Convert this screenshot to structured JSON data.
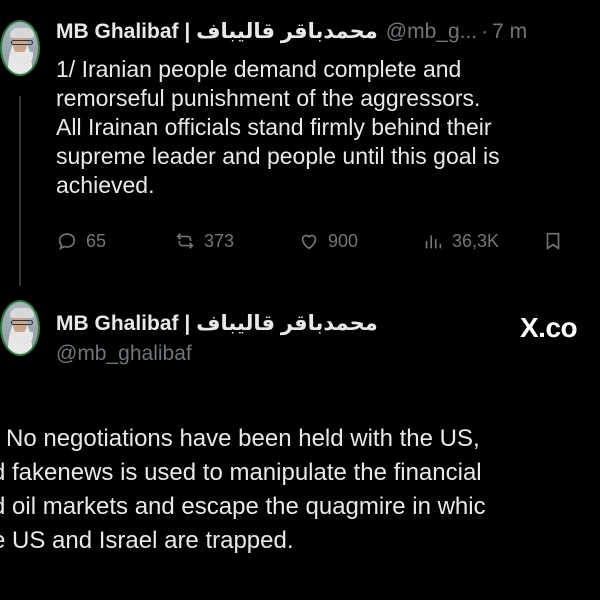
{
  "tweet1": {
    "display_name": "MB Ghalibaf | محمدباقر قالیباف",
    "handle": "@mb_g...",
    "separator": "·",
    "time": "7 m",
    "lines": [
      "1/ Iranian people demand complete and",
      "remorseful punishment of the aggressors.",
      "All Irainan officials stand firmly behind their",
      "supreme leader and people until this goal is",
      "achieved."
    ],
    "actions": {
      "replies": "65",
      "reposts": "373",
      "likes": "900",
      "views": "36,3K"
    }
  },
  "tweet2": {
    "display_name": "MB Ghalibaf | محمدباقر قالیباف",
    "handle": "@mb_ghalibaf",
    "brand": "X.co",
    "lines": [
      "No negotiations have been held with the US,",
      "d fakenews is used to manipulate the financial",
      "d oil markets and escape the quagmire in whic",
      "e US and Israel are trapped."
    ]
  },
  "icons": {
    "reply": "reply-icon",
    "repost": "repost-icon",
    "like": "heart-icon",
    "views": "views-icon",
    "bookmark": "bookmark-icon"
  }
}
